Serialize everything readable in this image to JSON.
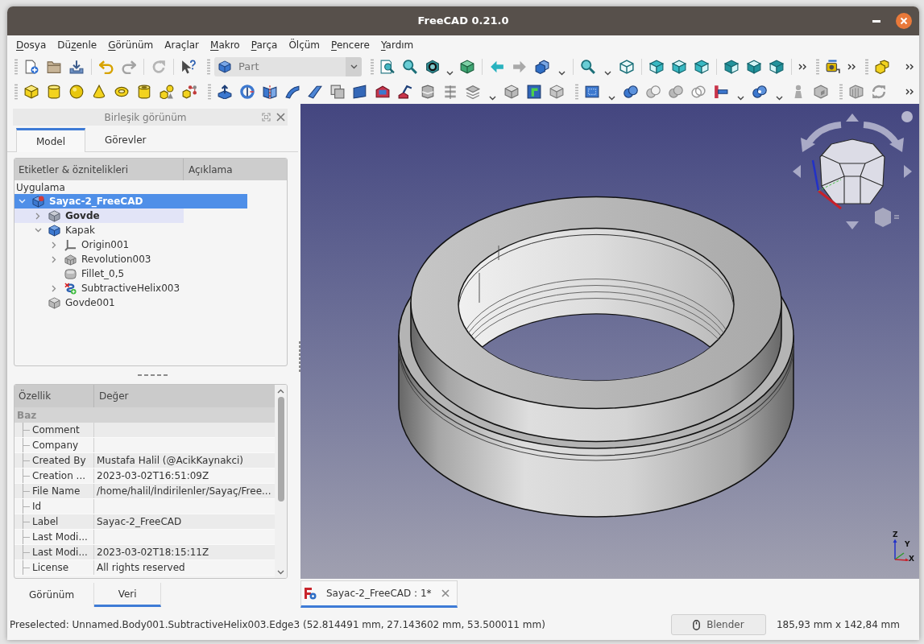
{
  "window": {
    "title": "FreeCAD 0.21.0"
  },
  "menu_bar": [
    {
      "parts": [
        {
          "text": "D",
          "underlined": true
        },
        {
          "text": "osya",
          "underlined": false
        }
      ]
    },
    {
      "parts": [
        {
          "text": "Dü",
          "underlined": false
        },
        {
          "text": "z",
          "underlined": true
        },
        {
          "text": "enle",
          "underlined": false
        }
      ]
    },
    {
      "parts": [
        {
          "text": "G",
          "underlined": true
        },
        {
          "text": "örünüm",
          "underlined": false
        }
      ]
    },
    {
      "parts": [
        {
          "text": "Araçlar",
          "underlined": false
        }
      ]
    },
    {
      "parts": [
        {
          "text": "M",
          "underlined": true
        },
        {
          "text": "akro",
          "underlined": false
        }
      ]
    },
    {
      "parts": [
        {
          "text": "P",
          "underlined": true
        },
        {
          "text": "arça",
          "underlined": false
        }
      ]
    },
    {
      "parts": [
        {
          "text": "Ölçüm",
          "underlined": false
        }
      ]
    },
    {
      "parts": [
        {
          "text": "P",
          "underlined": true
        },
        {
          "text": "encere",
          "underlined": false
        }
      ]
    },
    {
      "parts": [
        {
          "text": "Y",
          "underlined": true
        },
        {
          "text": "ardım",
          "underlined": false
        }
      ]
    }
  ],
  "toolbar": {
    "workbench": "Part"
  },
  "combo_view": {
    "title": "Birleşik görünüm",
    "tabs": [
      {
        "label": "Model",
        "selected": true
      },
      {
        "label": "Görevler",
        "selected": false
      }
    ]
  },
  "model_tree": {
    "columns": [
      "Etiketler & öznitelikleri",
      "Açıklama"
    ],
    "application": "Uygulama",
    "items": [
      {
        "label": "Sayac-2_FreeCAD",
        "kind": "document",
        "expanded": true,
        "selected": true,
        "highlighted": false,
        "active": true,
        "visible": true,
        "children": [
          {
            "label": "Govde",
            "kind": "body",
            "expanded": false,
            "selected": false,
            "highlighted": true,
            "active": true,
            "visible": false
          },
          {
            "label": "Kapak",
            "kind": "body",
            "expanded": true,
            "selected": false,
            "highlighted": false,
            "active": false,
            "visible": true,
            "children": [
              {
                "label": "Origin001",
                "kind": "origin",
                "expanded": false,
                "selected": false,
                "highlighted": false,
                "active": false,
                "visible": false
              },
              {
                "label": "Revolution003",
                "kind": "revolution",
                "expanded": false,
                "selected": false,
                "highlighted": false,
                "active": false,
                "visible": false
              },
              {
                "label": "Fillet_0,5",
                "kind": "fillet",
                "selected": false,
                "highlighted": false,
                "active": false,
                "visible": false
              },
              {
                "label": "SubtractiveHelix003",
                "kind": "helix",
                "expanded": false,
                "selected": false,
                "highlighted": false,
                "active": false,
                "visible": true
              }
            ]
          },
          {
            "label": "Govde001",
            "kind": "solid",
            "selected": false,
            "highlighted": false,
            "active": false,
            "visible": false
          }
        ]
      }
    ]
  },
  "property_view": {
    "columns": [
      "Özellik",
      "Değer"
    ],
    "groups": [
      {
        "label": "Baz",
        "rows": [
          {
            "name": "Comment"
          },
          {
            "name": "Company"
          },
          {
            "name": "Created By",
            "value": "Mustafa Halil (@AcikKaynakci)"
          },
          {
            "name": "Creation ...",
            "value": "2023-03-02T16:51:09Z"
          },
          {
            "name": "File Name",
            "value": "/home/halil/İndirilenler/Sayaç/Free..."
          },
          {
            "name": "Id"
          },
          {
            "name": "Label",
            "value": "Sayac-2_FreeCAD"
          },
          {
            "name": "Last Modi..."
          },
          {
            "name": "Last Modi...",
            "value": "2023-03-02T18:15:11Z"
          },
          {
            "name": "License",
            "value": "All rights reserved"
          }
        ]
      }
    ],
    "tabs": [
      {
        "label": "Görünüm",
        "selected": false
      },
      {
        "label": "Veri",
        "selected": true
      }
    ]
  },
  "viewport": {
    "axis_labels": [
      "Z",
      "Y",
      "X"
    ]
  },
  "document_tabs": [
    {
      "label": "Sayac-2_FreeCAD : 1*",
      "selected": true
    }
  ],
  "status_bar": {
    "message": "Preselected: Unnamed.Body001.SubtractiveHelix003.Edge3 (52.814491 mm, 27.143602 mm, 53.500011 mm)",
    "navigation_style": "Blender",
    "dimensions": "185,93 mm x 142,84 mm"
  }
}
